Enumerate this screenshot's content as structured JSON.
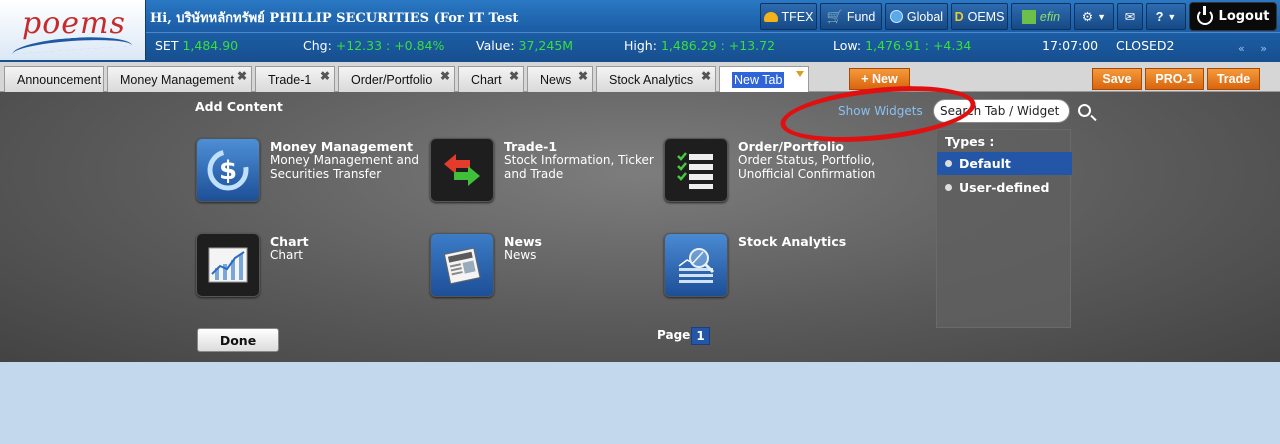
{
  "header": {
    "logo_text": "poems",
    "greeting": "Hi, บริษัทหลักทรัพย์ PHILLIP SECURITIES (For IT Test",
    "buttons": [
      {
        "label": "TFEX",
        "icon": "tfex-icon"
      },
      {
        "label": "Fund",
        "icon": "cart-icon"
      },
      {
        "label": "Global",
        "icon": "globe-icon"
      },
      {
        "label": "OEMS",
        "icon": "oems-icon"
      },
      {
        "label": "efin",
        "icon": "efin-icon"
      },
      {
        "label": "▼",
        "icon": "settings-icon"
      },
      {
        "label": "",
        "icon": "mail-icon"
      },
      {
        "label": "?",
        "icon": "help-icon"
      }
    ],
    "logout_label": "Logout"
  },
  "ticker": {
    "set_label": "SET",
    "set_value": "1,484.90",
    "chg_label": "Chg:",
    "chg_value": "+12.33 : +0.84%",
    "value_label": "Value:",
    "value_value": "37,245M",
    "high_label": "High:",
    "high_value": "1,486.29 : +13.72",
    "low_label": "Low:",
    "low_value": "1,476.91 : +4.34",
    "time": "17:07:00",
    "status": "CLOSED2",
    "nav_arrows": "« »"
  },
  "tabs": [
    {
      "label": "Announcement",
      "closable": false
    },
    {
      "label": "Money Management",
      "closable": true
    },
    {
      "label": "Trade-1",
      "closable": true
    },
    {
      "label": "Order/Portfolio",
      "closable": true
    },
    {
      "label": "Chart",
      "closable": true
    },
    {
      "label": "News",
      "closable": true
    },
    {
      "label": "Stock Analytics",
      "closable": true
    },
    {
      "label": "New Tab",
      "active": true
    }
  ],
  "new_button": "+ New",
  "right_buttons": {
    "save": "Save",
    "pro": "PRO-1",
    "trade": "Trade"
  },
  "panel": {
    "title": "Add Content",
    "show_widgets": "Show Widgets",
    "search_value": "Search Tab / Widget",
    "types_title": "Types :",
    "types": [
      "Default",
      "User-defined"
    ],
    "selected_type": "Default",
    "widgets": [
      {
        "title": "Money Management",
        "desc": "Money Management and Securities Transfer",
        "icon": "money-management-icon"
      },
      {
        "title": "Trade-1",
        "desc": "Stock Information, Ticker and Trade",
        "icon": "trade-arrows-icon"
      },
      {
        "title": "Order/Portfolio",
        "desc": "Order Status, Portfolio, Unofficial Confirmation",
        "icon": "order-checklist-icon"
      },
      {
        "title": "Chart",
        "desc": "Chart",
        "icon": "chart-icon"
      },
      {
        "title": "News",
        "desc": "News",
        "icon": "newspaper-icon"
      },
      {
        "title": "Stock Analytics",
        "desc": "",
        "icon": "stock-analytics-icon"
      }
    ],
    "done_label": "Done",
    "page_label": "Page:",
    "page_number": "1"
  },
  "colors": {
    "header_blue": "#1c5fa8",
    "ticker_green": "#37e03a",
    "accent_orange": "#e47a1f",
    "selected_blue": "#2456a8",
    "highlight_red": "#e01010"
  }
}
